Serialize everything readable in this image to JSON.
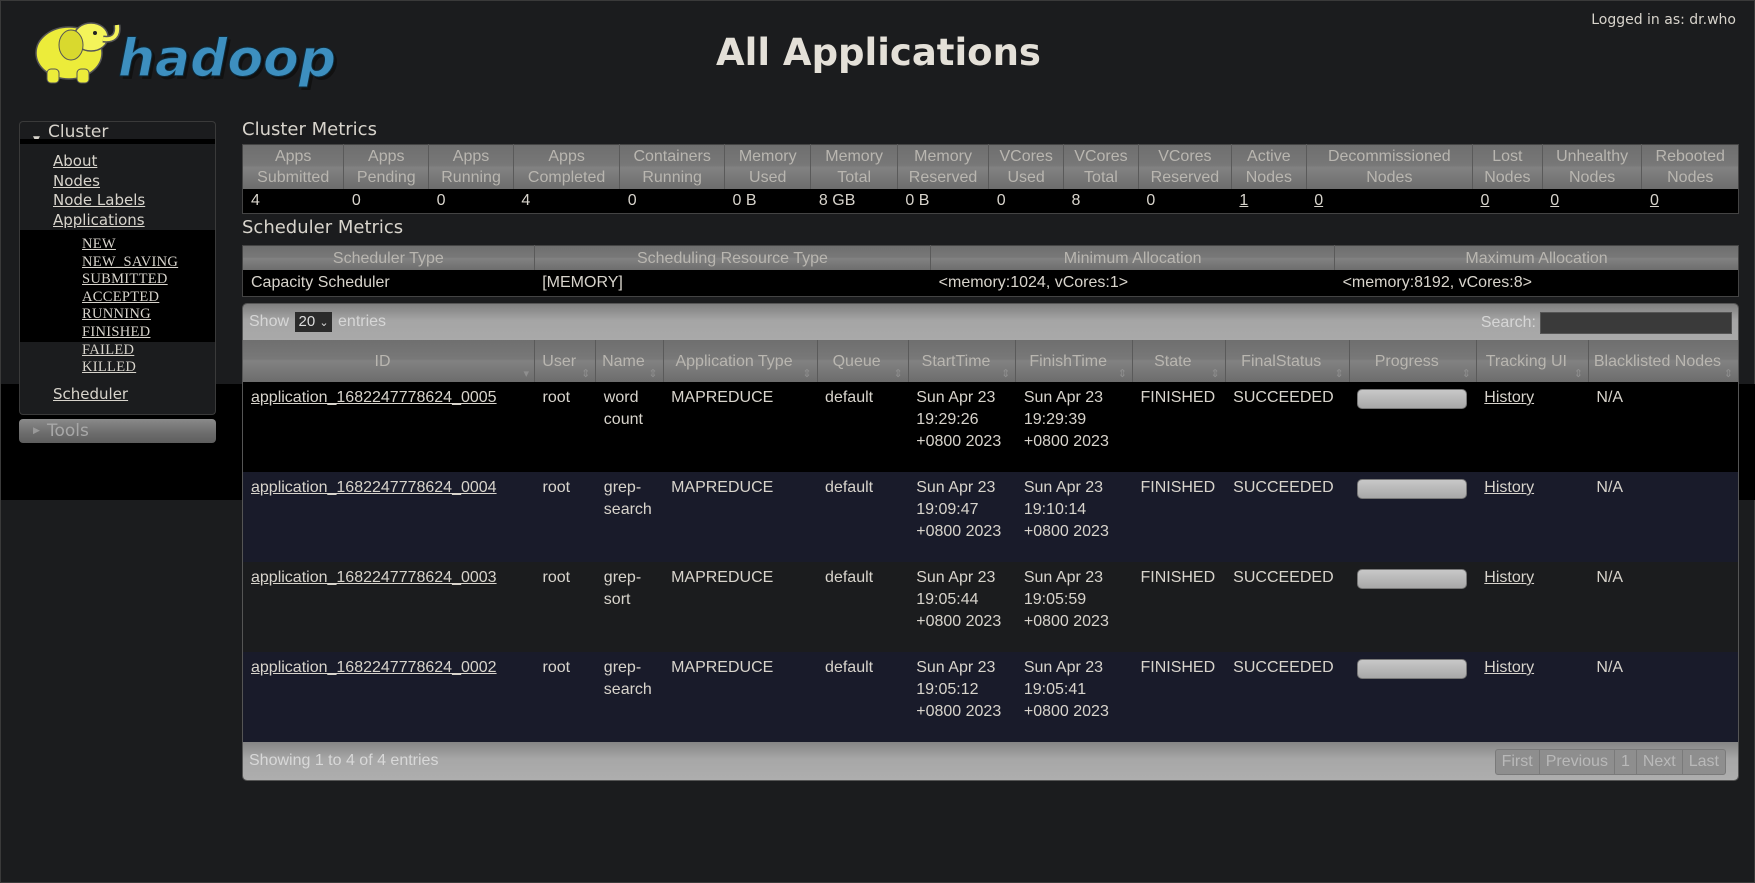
{
  "header": {
    "logo_text": "hadoop",
    "title": "All Applications",
    "login": "Logged in as: dr.who"
  },
  "sidebar": {
    "cluster_label": "Cluster",
    "items": [
      {
        "label": "About"
      },
      {
        "label": "Nodes"
      },
      {
        "label": "Node Labels"
      },
      {
        "label": "Applications"
      }
    ],
    "app_states": [
      "NEW",
      "NEW_SAVING",
      "SUBMITTED",
      "ACCEPTED",
      "RUNNING",
      "FINISHED",
      "FAILED",
      "KILLED"
    ],
    "scheduler_label": "Scheduler",
    "tools_label": "Tools"
  },
  "cluster_metrics": {
    "title": "Cluster Metrics",
    "headers": [
      [
        "Apps",
        "Submitted"
      ],
      [
        "Apps",
        "Pending"
      ],
      [
        "Apps",
        "Running"
      ],
      [
        "Apps",
        "Completed"
      ],
      [
        "Containers",
        "Running"
      ],
      [
        "Memory",
        "Used"
      ],
      [
        "Memory",
        "Total"
      ],
      [
        "Memory",
        "Reserved"
      ],
      [
        "VCores",
        "Used"
      ],
      [
        "VCores",
        "Total"
      ],
      [
        "VCores",
        "Reserved"
      ],
      [
        "Active",
        "Nodes"
      ],
      [
        "Decommissioned",
        "Nodes"
      ],
      [
        "Lost",
        "Nodes"
      ],
      [
        "Unhealthy",
        "Nodes"
      ],
      [
        "Rebooted",
        "Nodes"
      ]
    ],
    "values": [
      "4",
      "0",
      "0",
      "4",
      "0",
      "0 B",
      "8 GB",
      "0 B",
      "0",
      "8",
      "0",
      "1",
      "0",
      "0",
      "0",
      "0"
    ]
  },
  "scheduler_metrics": {
    "title": "Scheduler Metrics",
    "headers": [
      "Scheduler Type",
      "Scheduling Resource Type",
      "Minimum Allocation",
      "Maximum Allocation"
    ],
    "values": [
      "Capacity Scheduler",
      "[MEMORY]",
      "<memory:1024, vCores:1>",
      "<memory:8192, vCores:8>"
    ]
  },
  "apps_table": {
    "show_label": "Show",
    "page_size": "20",
    "entries_label": "entries",
    "search_label": "Search:",
    "search_value": "",
    "headers": [
      "ID",
      "User",
      "Name",
      "Application Type",
      "Queue",
      "StartTime",
      "FinishTime",
      "State",
      "FinalStatus",
      "Progress",
      "Tracking UI",
      "Blacklisted Nodes"
    ],
    "rows": [
      {
        "id": "application_1682247778624_0005",
        "user": "root",
        "name": "word count",
        "type": "MAPREDUCE",
        "queue": "default",
        "start": "Sun Apr 23 19:29:26 +0800 2023",
        "finish": "Sun Apr 23 19:29:39 +0800 2023",
        "state": "FINISHED",
        "final_status": "SUCCEEDED",
        "progress": 100,
        "tracking": "History",
        "blacklisted": "N/A"
      },
      {
        "id": "application_1682247778624_0004",
        "user": "root",
        "name": "grep-search",
        "type": "MAPREDUCE",
        "queue": "default",
        "start": "Sun Apr 23 19:09:47 +0800 2023",
        "finish": "Sun Apr 23 19:10:14 +0800 2023",
        "state": "FINISHED",
        "final_status": "SUCCEEDED",
        "progress": 100,
        "tracking": "History",
        "blacklisted": "N/A"
      },
      {
        "id": "application_1682247778624_0003",
        "user": "root",
        "name": "grep-sort",
        "type": "MAPREDUCE",
        "queue": "default",
        "start": "Sun Apr 23 19:05:44 +0800 2023",
        "finish": "Sun Apr 23 19:05:59 +0800 2023",
        "state": "FINISHED",
        "final_status": "SUCCEEDED",
        "progress": 100,
        "tracking": "History",
        "blacklisted": "N/A"
      },
      {
        "id": "application_1682247778624_0002",
        "user": "root",
        "name": "grep-search",
        "type": "MAPREDUCE",
        "queue": "default",
        "start": "Sun Apr 23 19:05:12 +0800 2023",
        "finish": "Sun Apr 23 19:05:41 +0800 2023",
        "state": "FINISHED",
        "final_status": "SUCCEEDED",
        "progress": 100,
        "tracking": "History",
        "blacklisted": "N/A"
      }
    ],
    "info": "Showing 1 to 4 of 4 entries",
    "pager": [
      "First",
      "Previous",
      "1",
      "Next",
      "Last"
    ]
  },
  "colors": {
    "background": "#1b1c1e",
    "text": "#d8d4cc",
    "header_gray": "#787878",
    "logo_blue": "#3d8fbf",
    "logo_yellow": "#f2f23a"
  }
}
